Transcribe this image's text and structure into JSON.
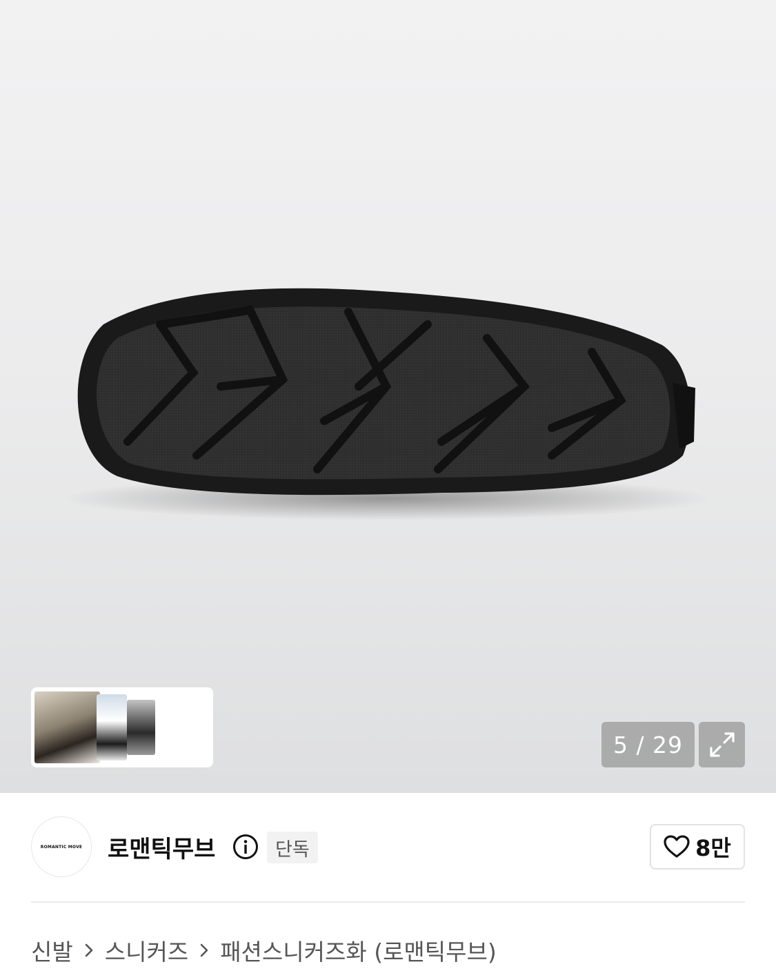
{
  "gallery": {
    "current": "5",
    "total": "29",
    "counter_text": "5 / 29",
    "expand_icon": "expand-icon",
    "thumbnails": [
      "lifestyle-shoes",
      "white-socks-shoes",
      "black-shoes"
    ]
  },
  "brand": {
    "logo_text": "ROMANTIC MOVE",
    "name": "로맨틱무브",
    "info_icon": "info-icon",
    "badge": "단독"
  },
  "like": {
    "icon": "heart-icon",
    "count": "8만"
  },
  "breadcrumb": {
    "items": [
      "신발",
      "스니커즈",
      "패션스니커즈화 (로맨틱무브)"
    ],
    "separator_icon": "chevron-right-icon"
  },
  "colors": {
    "overlay_button": "#969696",
    "badge_bg": "#f2f2f2",
    "divider": "#e9e9e9"
  }
}
